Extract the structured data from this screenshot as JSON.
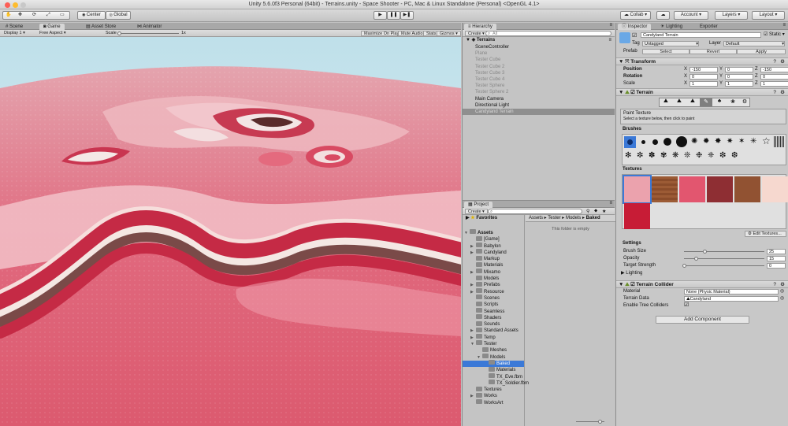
{
  "window": {
    "title": "Unity 5.6.0f3 Personal (64bit) - Terrains.unity - Space Shooter - PC, Mac & Linux Standalone (Personal) <OpenGL 4.1>"
  },
  "toolbar": {
    "pivot_label": "Center",
    "space_label": "Global",
    "collab_label": "Collab ▾",
    "account_label": "Account",
    "layers_label": "Layers",
    "layout_label": "Layout"
  },
  "scene_tabs": [
    "Scene",
    "Game",
    "Asset Store",
    "Animator"
  ],
  "game_bar": {
    "display": "Display 1",
    "aspect": "Free Aspect",
    "scale_label": "Scale",
    "scale_value": "1x",
    "scale_fraction": 0.02,
    "maximize": "Maximize On Play",
    "mute": "Mute Audio",
    "stats": "Stats",
    "gizmos": "Gizmos ▾"
  },
  "hierarchy": {
    "tab": "Hierarchy",
    "create": "Create ▾",
    "search_placeholder": "All",
    "scene": "Terrains",
    "items": [
      {
        "label": "SceneController",
        "active": true
      },
      {
        "label": "Plane",
        "active": false
      },
      {
        "label": "Tester Cube",
        "active": false
      },
      {
        "label": "Tester Cube 2",
        "active": false
      },
      {
        "label": "Tester Cube 3",
        "active": false
      },
      {
        "label": "Tester Cube 4",
        "active": false
      },
      {
        "label": "Tester Sphere",
        "active": false
      },
      {
        "label": "Tester Sphere 2",
        "active": false
      },
      {
        "label": "Main Camera",
        "active": true
      },
      {
        "label": "Directional Light",
        "active": true
      },
      {
        "label": "Candyland Terrain",
        "active": true,
        "selected": true
      }
    ]
  },
  "project": {
    "tab": "Project",
    "create": "Create ▾",
    "favorites": "Favorites",
    "breadcrumb": [
      "Assets",
      "Tester",
      "Models",
      "Baked"
    ],
    "empty_message": "This folder is empty",
    "tree": [
      {
        "label": "Assets",
        "depth": 0,
        "open": true,
        "bold": true
      },
      {
        "label": "[Game]",
        "depth": 1
      },
      {
        "label": "Babylon",
        "depth": 1,
        "arrow": true
      },
      {
        "label": "Candyland",
        "depth": 1,
        "arrow": true
      },
      {
        "label": "Markup",
        "depth": 1
      },
      {
        "label": "Materials",
        "depth": 1
      },
      {
        "label": "Mixamo",
        "depth": 1,
        "arrow": true
      },
      {
        "label": "Models",
        "depth": 1
      },
      {
        "label": "Prefabs",
        "depth": 1,
        "arrow": true
      },
      {
        "label": "Resource",
        "depth": 1,
        "arrow": true
      },
      {
        "label": "Scenes",
        "depth": 1
      },
      {
        "label": "Scripts",
        "depth": 1
      },
      {
        "label": "Seamless",
        "depth": 1
      },
      {
        "label": "Shaders",
        "depth": 1
      },
      {
        "label": "Sounds",
        "depth": 1
      },
      {
        "label": "Standard Assets",
        "depth": 1,
        "arrow": true
      },
      {
        "label": "Temp",
        "depth": 1,
        "arrow": true
      },
      {
        "label": "Tester",
        "depth": 1,
        "open": true
      },
      {
        "label": "Meshes",
        "depth": 2
      },
      {
        "label": "Models",
        "depth": 2,
        "open": true
      },
      {
        "label": "Baked",
        "depth": 3,
        "selected": true
      },
      {
        "label": "Materials",
        "depth": 3
      },
      {
        "label": "TX_Eve.fbm",
        "depth": 3
      },
      {
        "label": "TX_Soldier.fbm",
        "depth": 3
      },
      {
        "label": "Textures",
        "depth": 1
      },
      {
        "label": "Works",
        "depth": 1,
        "arrow": true
      },
      {
        "label": "WorksArt",
        "depth": 1
      }
    ]
  },
  "inspector": {
    "tab_inspector": "Inspector",
    "tab_lighting": "Lighting",
    "tab_exporter": "Exporter",
    "object_name": "Candyland Terrain",
    "static_label": "Static",
    "tag_label": "Tag",
    "tag_value": "Untagged",
    "layer_label": "Layer",
    "layer_value": "Default",
    "prefab_label": "Prefab",
    "prefab_select": "Select",
    "prefab_revert": "Revert",
    "prefab_apply": "Apply",
    "transform": {
      "title": "Transform",
      "rows": [
        {
          "label": "Position",
          "x": "-150",
          "y": "0",
          "z": "-150"
        },
        {
          "label": "Rotation",
          "x": "0",
          "y": "0",
          "z": "0"
        },
        {
          "label": "Scale",
          "x": "1",
          "y": "1",
          "z": "1"
        }
      ]
    },
    "terrain": {
      "title": "Terrain",
      "tool_title": "Paint Texture",
      "tool_hint": "Select a texture below, then click to paint",
      "brushes_label": "Brushes",
      "textures_label": "Textures",
      "edit_textures": "Edit Textures...",
      "settings_label": "Settings",
      "settings": [
        {
          "label": "Brush Size",
          "value": "25",
          "fraction": 0.25
        },
        {
          "label": "Opacity",
          "value": "15",
          "fraction": 0.15
        },
        {
          "label": "Target Strength",
          "value": "0",
          "fraction": 0
        }
      ],
      "lighting_label": "Lighting"
    },
    "collider": {
      "title": "Terrain Collider",
      "material_label": "Material",
      "material_value": "None (Physic Material)",
      "data_label": "Terrain Data",
      "data_value": "Candyland",
      "trees_label": "Enable Tree Colliders"
    },
    "add_component": "Add Component"
  },
  "colors": {
    "selection": "#3b79d7",
    "terrain_pink": "#e0607a",
    "sky": "#c9e4ee"
  }
}
